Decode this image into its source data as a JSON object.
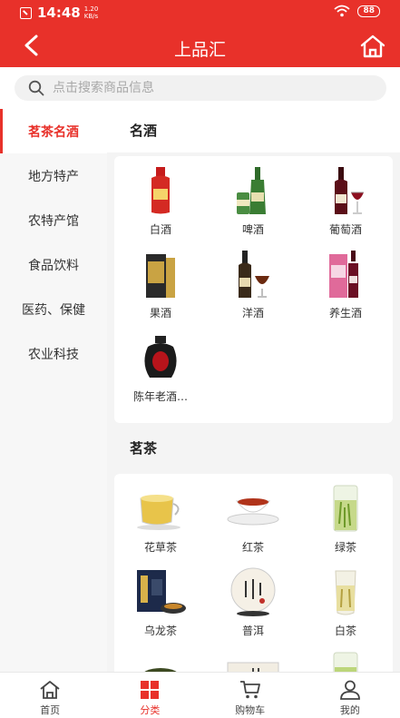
{
  "status_bar": {
    "time": "14:48",
    "speed_value": "1.20",
    "speed_unit": "KB/s",
    "battery": "88"
  },
  "header": {
    "title": "上品汇"
  },
  "search": {
    "placeholder": "点击搜索商品信息"
  },
  "sidebar": {
    "items": [
      {
        "label": "茗茶名酒",
        "active": true
      },
      {
        "label": "地方特产"
      },
      {
        "label": "农特产馆"
      },
      {
        "label": "食品饮料"
      },
      {
        "label": "医药、保健"
      },
      {
        "label": "农业科技"
      }
    ]
  },
  "sections": [
    {
      "title": "名酒",
      "products": [
        {
          "name": "白酒",
          "icon": "baijiu-bottle-icon"
        },
        {
          "name": "啤酒",
          "icon": "beer-icon"
        },
        {
          "name": "葡萄酒",
          "icon": "wine-icon"
        },
        {
          "name": "果酒",
          "icon": "fruit-wine-icon"
        },
        {
          "name": "洋酒",
          "icon": "liquor-icon"
        },
        {
          "name": "养生酒",
          "icon": "health-wine-icon"
        },
        {
          "name": "陈年老酒…",
          "icon": "aged-wine-jar-icon"
        }
      ]
    },
    {
      "title": "茗茶",
      "products": [
        {
          "name": "花草茶",
          "icon": "herbal-tea-icon"
        },
        {
          "name": "红茶",
          "icon": "black-tea-icon"
        },
        {
          "name": "绿茶",
          "icon": "green-tea-icon"
        },
        {
          "name": "乌龙茶",
          "icon": "oolong-tea-icon"
        },
        {
          "name": "普洱",
          "icon": "puer-tea-icon"
        },
        {
          "name": "白茶",
          "icon": "white-tea-icon"
        },
        {
          "name": "",
          "icon": "tea-leaves-icon"
        },
        {
          "name": "",
          "icon": "tea-box-icon"
        },
        {
          "name": "",
          "icon": "tea-glass-icon"
        }
      ]
    }
  ],
  "tabbar": {
    "tabs": [
      {
        "label": "首页",
        "icon": "home-icon"
      },
      {
        "label": "分类",
        "icon": "category-icon",
        "active": true
      },
      {
        "label": "购物车",
        "icon": "cart-icon"
      },
      {
        "label": "我的",
        "icon": "user-icon"
      }
    ]
  },
  "colors": {
    "brand": "#e8312a",
    "background": "#f4f4f4",
    "inactive_text": "#444444"
  }
}
